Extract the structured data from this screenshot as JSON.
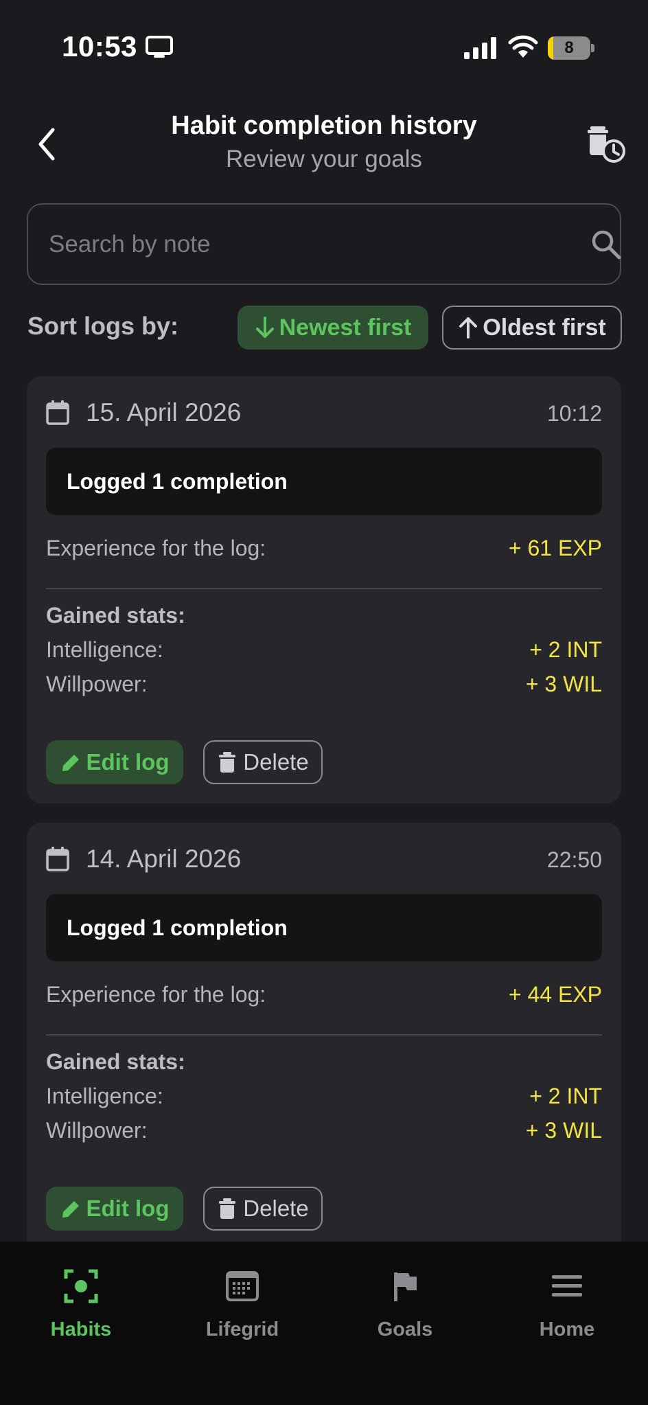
{
  "status_bar": {
    "time": "10:53",
    "battery": "8"
  },
  "header": {
    "title": "Habit completion history",
    "subtitle": "Review your goals"
  },
  "search": {
    "placeholder": "Search by note",
    "value": ""
  },
  "sort": {
    "label": "Sort logs by:",
    "newest": "Newest first",
    "oldest": "Oldest first",
    "selected": "newest"
  },
  "logs": [
    {
      "date": "15. April 2026",
      "time": "10:12",
      "summary": "Logged 1 completion",
      "exp_label": "Experience for the log:",
      "exp_value": "+ 61 EXP",
      "stats_heading": "Gained stats:",
      "stats": [
        {
          "label": "Intelligence:",
          "value": "+ 2 INT"
        },
        {
          "label": "Willpower:",
          "value": "+ 3 WIL"
        }
      ],
      "edit_label": "Edit log",
      "delete_label": "Delete"
    },
    {
      "date": "14. April 2026",
      "time": "22:50",
      "summary": "Logged 1 completion",
      "exp_label": "Experience for the log:",
      "exp_value": "+ 44 EXP",
      "stats_heading": "Gained stats:",
      "stats": [
        {
          "label": "Intelligence:",
          "value": "+ 2 INT"
        },
        {
          "label": "Willpower:",
          "value": "+ 3 WIL"
        }
      ],
      "edit_label": "Edit log",
      "delete_label": "Delete"
    }
  ],
  "nav": [
    {
      "label": "Habits",
      "icon": "habits-icon",
      "active": true
    },
    {
      "label": "Lifegrid",
      "icon": "lifegrid-icon",
      "active": false
    },
    {
      "label": "Goals",
      "icon": "flag-icon",
      "active": false
    },
    {
      "label": "Home",
      "icon": "menu-icon",
      "active": false
    }
  ],
  "colors": {
    "background": "#1b1b1f",
    "card": "#26262b",
    "accent_green": "#5dc55f",
    "accent_green_bg": "#2f4f33",
    "exp_yellow": "#f4e544"
  }
}
